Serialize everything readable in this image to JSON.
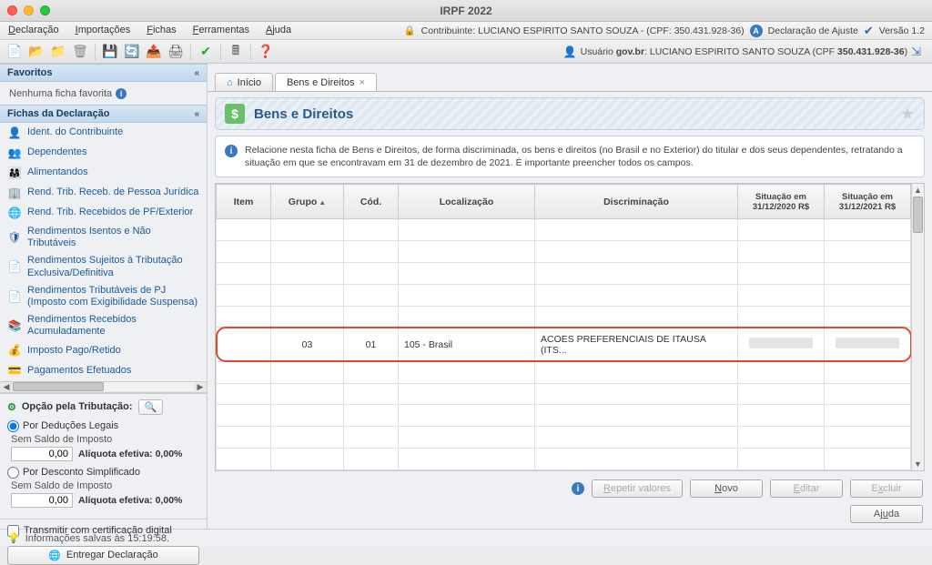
{
  "window": {
    "title": "IRPF 2022"
  },
  "menus": [
    "Declaração",
    "Importações",
    "Fichas",
    "Ferramentas",
    "Ajuda"
  ],
  "topright": {
    "contribuinte_label": "Contribuinte: ",
    "contribuinte_name": "LUCIANO ESPIRITO SANTO SOUZA - (CPF: 350.431.928-36)",
    "decl_tipo": "Declaração de Ajuste",
    "versao": "Versão 1.2"
  },
  "toolbar_user": {
    "prefix": "Usuário ",
    "govbr": "gov.br",
    "rest": ": LUCIANO ESPIRITO SANTO SOUZA (CPF ",
    "cpf_bold": "350.431.928-36",
    "suffix": ")"
  },
  "sidebar": {
    "favoritos_title": "Favoritos",
    "favoritos_empty": "Nenhuma ficha favorita",
    "fichas_title": "Fichas da Declaração",
    "fichas": [
      "Ident. do Contribuinte",
      "Dependentes",
      "Alimentandos",
      "Rend. Trib. Receb. de Pessoa Jurídica",
      "Rend. Trib. Recebidos de PF/Exterior",
      "Rendimentos Isentos e Não Tributáveis",
      "Rendimentos Sujeitos à Tributação Exclusiva/Definitiva",
      "Rendimentos Tributáveis de PJ (Imposto com Exigibilidade Suspensa)",
      "Rendimentos Recebidos Acumuladamente",
      "Imposto Pago/Retido",
      "Pagamentos Efetuados"
    ],
    "trib": {
      "title": "Opção pela Tributação:",
      "r1": "Por Deduções Legais",
      "r2": "Por Desconto Simplificado",
      "sem_saldo": "Sem Saldo de Imposto",
      "zero": "0,00",
      "aliq": "Alíquota efetiva: 0,00%"
    },
    "cert": "Transmitir com certificação digital",
    "entregar": "Entregar Declaração"
  },
  "tabs": {
    "inicio": "Início",
    "bens": "Bens e Direitos"
  },
  "page": {
    "title": "Bens e Direitos",
    "info": "Relacione nesta ficha de Bens e Direitos, de forma discriminada, os bens e direitos (no Brasil e no Exterior) do titular e dos seus dependentes, retratando a situação em que se encontravam em 31 de dezembro de 2021. É importante preencher todos os campos."
  },
  "table": {
    "headers": {
      "item": "Item",
      "grupo": "Grupo",
      "cod": "Cód.",
      "loc": "Localização",
      "disc": "Discriminação",
      "s2020": "Situação em 31/12/2020 R$",
      "s2021": "Situação em 31/12/2021 R$"
    },
    "row": {
      "grupo": "03",
      "cod": "01",
      "loc": "105 - Brasil",
      "disc": "ACOES PREFERENCIAIS DE ITAUSA (ITS..."
    }
  },
  "actions": {
    "repetir": "Repetir valores",
    "novo": "Novo",
    "editar": "Editar",
    "excluir": "Excluir",
    "ajuda": "Ajuda"
  },
  "status": "Informações salvas às 15:19:58."
}
